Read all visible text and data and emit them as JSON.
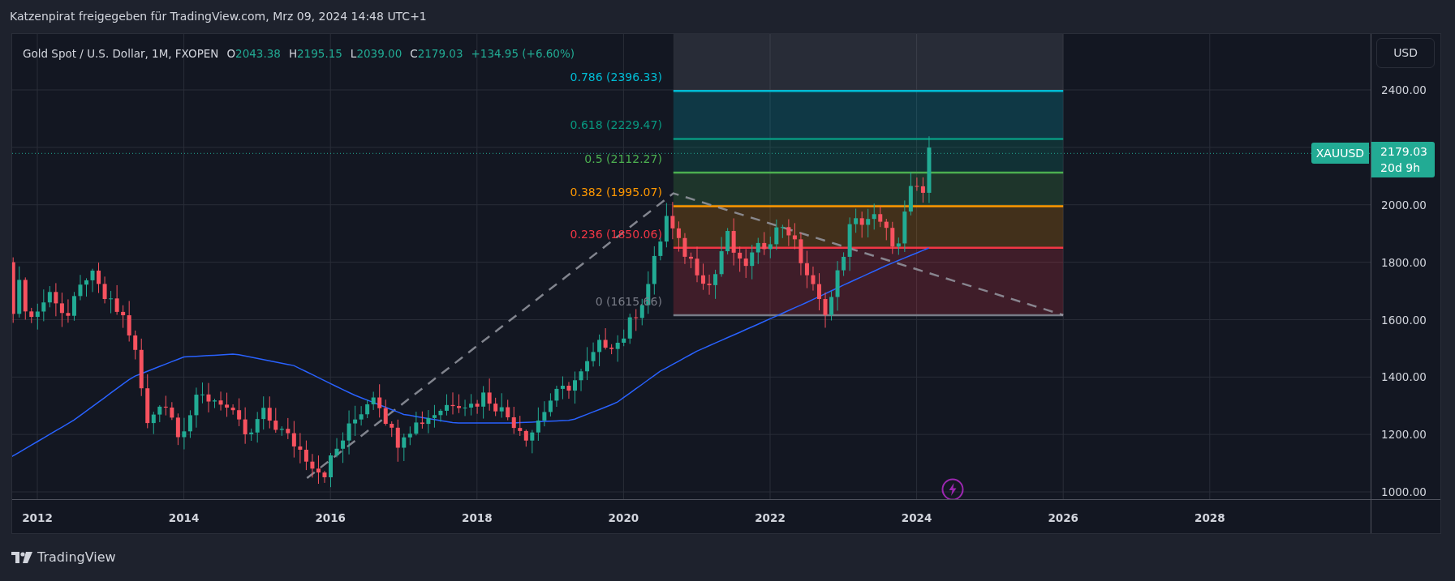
{
  "header": {
    "text": "Katzenpirat freigegeben für TradingView.com, Mrz 09, 2024 14:48 UTC+1"
  },
  "legend": {
    "symbol": "Gold Spot / U.S. Dollar, 1M, FXOPEN",
    "ohlc": [
      {
        "key": "O",
        "value": "2043.38"
      },
      {
        "key": "H",
        "value": "2195.15"
      },
      {
        "key": "L",
        "value": "2039.00"
      },
      {
        "key": "C",
        "value": "2179.03"
      }
    ],
    "change": "+134.95 (+6.60%)"
  },
  "fib_levels": [
    {
      "label": "0.786 (2396.33)",
      "color": "#00bcd4"
    },
    {
      "label": "0.618 (2229.47)",
      "color": "#089981"
    },
    {
      "label": "0.5 (2112.27)",
      "color": "#4caf50"
    },
    {
      "label": "0.382 (1995.07)",
      "color": "#ff9800"
    },
    {
      "label": "0.236 (1850.06)",
      "color": "#f23645"
    },
    {
      "label": "0 (1615.66)",
      "color": "#787b86"
    }
  ],
  "currency_button": "USD",
  "price_axis": [
    "2400.00",
    "2000.00",
    "1800.00",
    "1600.00",
    "1400.00",
    "1200.00",
    "1000.00"
  ],
  "price_tag": {
    "symbol": "XAUUSD",
    "price": "2179.03",
    "countdown": "20d 9h"
  },
  "time_axis": [
    "2012",
    "2014",
    "2016",
    "2018",
    "2020",
    "2022",
    "2024",
    "2026",
    "2028"
  ],
  "footer": {
    "brand": "TradingView"
  }
}
